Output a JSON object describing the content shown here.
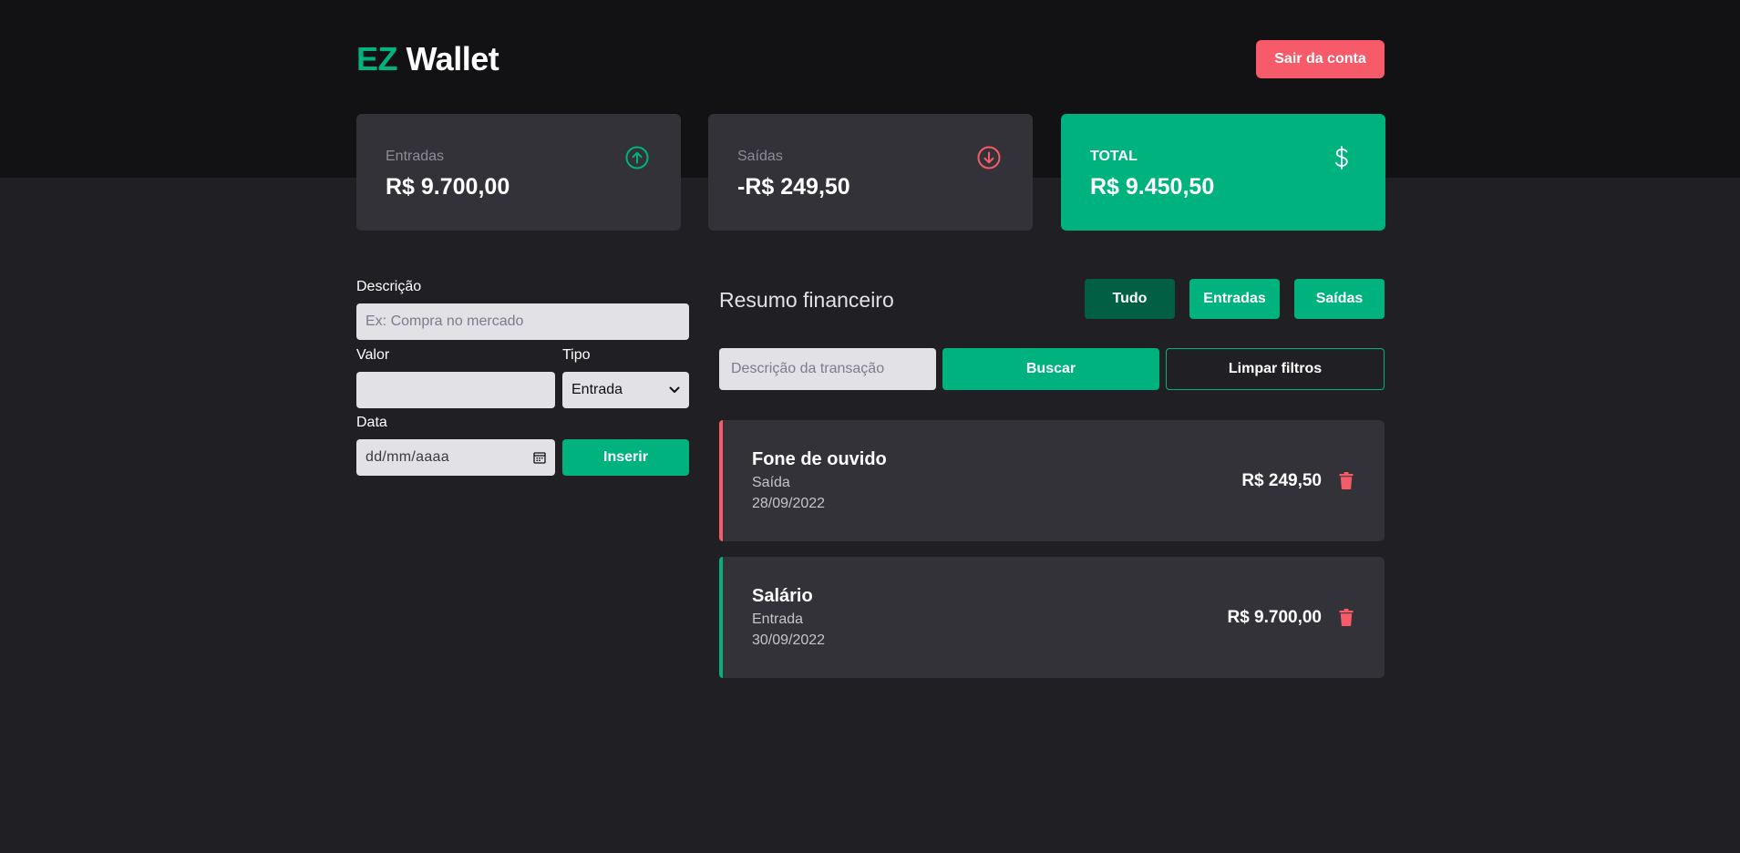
{
  "header": {
    "logo_accent": "EZ",
    "logo_rest": "Wallet",
    "logout_label": "Sair da conta"
  },
  "cards": {
    "income": {
      "label": "Entradas",
      "value": "R$ 9.700,00",
      "icon": "arrow-up-circle-icon"
    },
    "outcome": {
      "label": "Saídas",
      "value": "-R$ 249,50",
      "icon": "arrow-down-circle-icon"
    },
    "total": {
      "label": "TOTAL",
      "value": "R$ 9.450,50",
      "icon": "dollar-sign-icon"
    }
  },
  "form": {
    "description_label": "Descrição",
    "description_placeholder": "Ex: Compra no mercado",
    "value_label": "Valor",
    "value_value": "",
    "type_label": "Tipo",
    "type_selected": "Entrada",
    "date_label": "Data",
    "date_placeholder": "dd/mm/aaaa",
    "insert_label": "Inserir"
  },
  "summary": {
    "title": "Resumo financeiro",
    "filters": [
      {
        "label": "Tudo",
        "active": true
      },
      {
        "label": "Entradas",
        "active": false
      },
      {
        "label": "Saídas",
        "active": false
      }
    ],
    "search_placeholder": "Descrição da transação",
    "search_label": "Buscar",
    "clear_label": "Limpar filtros"
  },
  "transactions": [
    {
      "title": "Fone de ouvido",
      "type": "Saída",
      "date": "28/09/2022",
      "amount": "R$ 249,50",
      "kind": "outcome"
    },
    {
      "title": "Salário",
      "type": "Entrada",
      "date": "30/09/2022",
      "amount": "R$ 9.700,00",
      "kind": "income"
    }
  ],
  "colors": {
    "accent_green": "#00b37e",
    "accent_green_dark": "#015f43",
    "accent_red": "#f75a68",
    "bg_dark": "#121214",
    "bg": "#202024",
    "card": "#323238"
  }
}
